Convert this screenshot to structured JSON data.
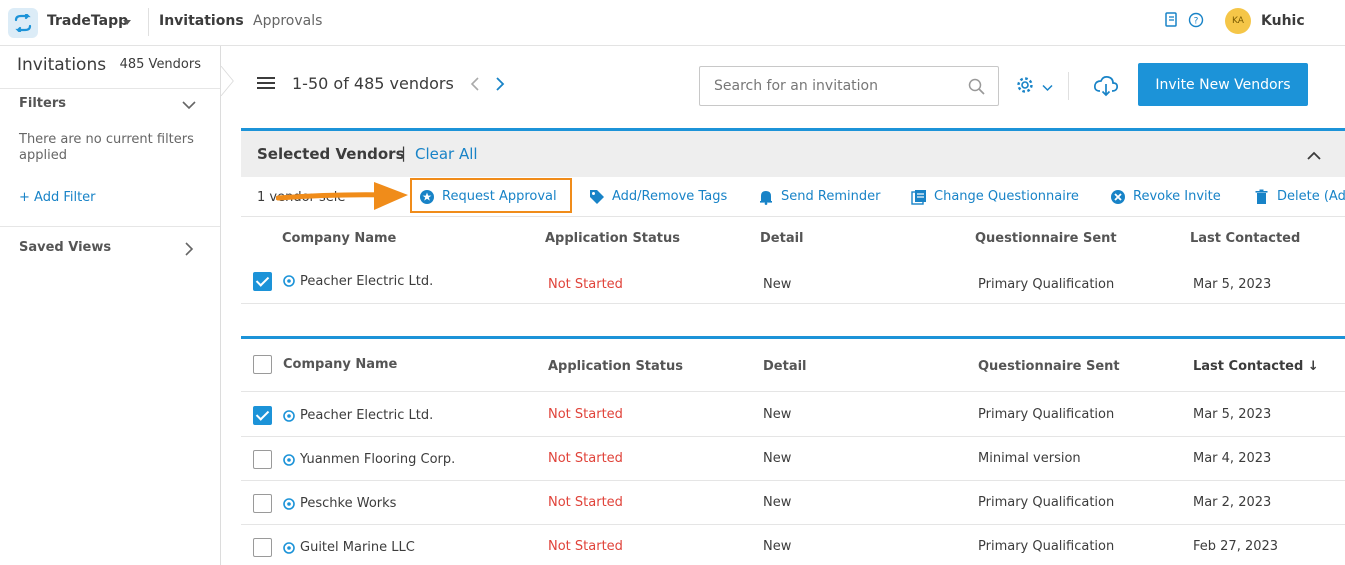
{
  "topbar": {
    "app_name": "TradeTapp",
    "nav": [
      "Invitations",
      "Approvals"
    ],
    "avatar_initials": "KA",
    "username": "Kuhic"
  },
  "sidebar": {
    "title": "Invitations",
    "vendor_count": "485 Vendors",
    "filters_label": "Filters",
    "no_filters": "There are no current filters applied",
    "add_filter": "+ Add Filter",
    "saved_views": "Saved Views"
  },
  "header": {
    "range": "1-50 of 485 vendors",
    "search_placeholder": "Search for an invitation",
    "invite_button": "Invite New Vendors"
  },
  "selected": {
    "title": "Selected Vendors",
    "separator": "|",
    "clear_all": "Clear All",
    "vendor_selected": "1 vendor sele",
    "actions": [
      "Request Approval",
      "Add/Remove Tags",
      "Send Reminder",
      "Change Questionnaire",
      "Revoke Invite",
      "Delete (Ad"
    ],
    "columns": [
      "Company Name",
      "Application Status",
      "Detail",
      "Questionnaire Sent",
      "Last Contacted"
    ],
    "rows": [
      {
        "company": "Peacher Electric Ltd.",
        "status": "Not Started",
        "detail": "New",
        "questionnaire": "Primary Qualification",
        "last_contacted": "Mar 5, 2023",
        "checked": true
      }
    ]
  },
  "table": {
    "columns": [
      "Company Name",
      "Application Status",
      "Detail",
      "Questionnaire Sent",
      "Last Contacted ↓"
    ],
    "rows": [
      {
        "company": "Peacher Electric Ltd.",
        "status": "Not Started",
        "detail": "New",
        "questionnaire": "Primary Qualification",
        "last_contacted": "Mar 5, 2023",
        "checked": true
      },
      {
        "company": "Yuanmen Flooring Corp.",
        "status": "Not Started",
        "detail": "New",
        "questionnaire": "Minimal version",
        "last_contacted": "Mar 4, 2023",
        "checked": false
      },
      {
        "company": "Peschke Works",
        "status": "Not Started",
        "detail": "New",
        "questionnaire": "Primary Qualification",
        "last_contacted": "Mar 2, 2023",
        "checked": false
      },
      {
        "company": "Guitel Marine LLC",
        "status": "Not Started",
        "detail": "New",
        "questionnaire": "Primary Qualification",
        "last_contacted": "Feb 27, 2023",
        "checked": false
      }
    ]
  },
  "colors": {
    "accent": "#1c93d8",
    "link": "#1883c7",
    "status_red": "#e0433a",
    "highlight_orange": "#f08c1a",
    "avatar": "#f5c648"
  },
  "icons": [
    "app-logo-icon",
    "caret-down-icon",
    "book-icon",
    "help-icon",
    "chevron-down-icon",
    "chevron-right-icon",
    "hamburger-icon",
    "chevron-left-icon",
    "search-icon",
    "gear-icon",
    "cloud-download-icon",
    "chevron-up-icon",
    "request-approval-icon",
    "tag-icon",
    "bell-icon",
    "questionnaire-icon",
    "revoke-icon",
    "trash-icon",
    "company-icon",
    "callout-arrow-icon"
  ]
}
